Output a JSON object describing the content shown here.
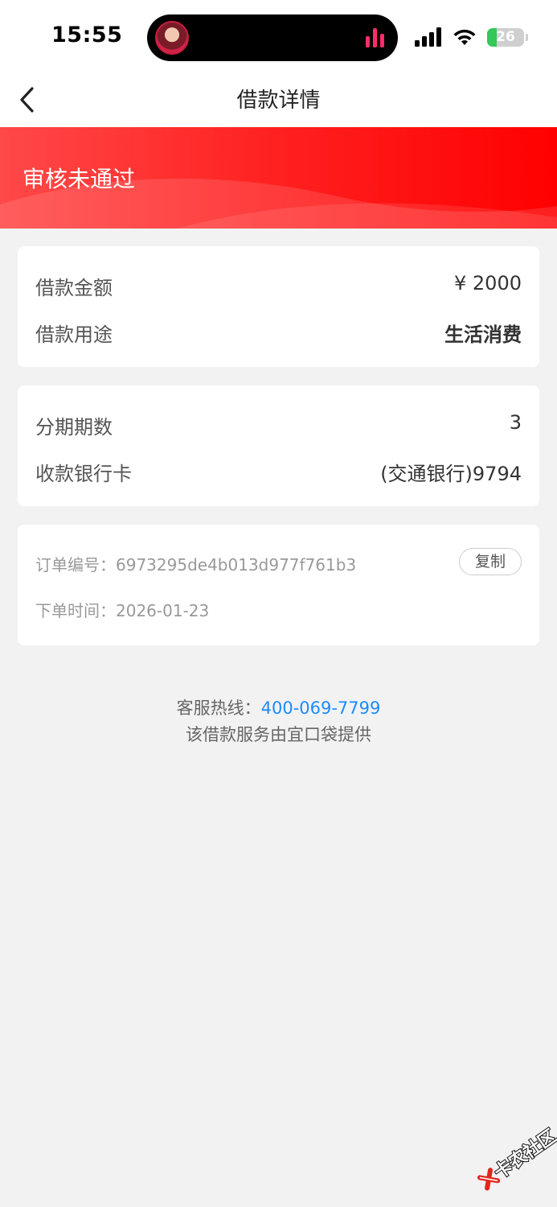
{
  "status_bar": {
    "time": "15:55",
    "battery": "26",
    "battery_level": 0.26
  },
  "nav": {
    "title": "借款详情"
  },
  "banner": {
    "status": "审核未通过"
  },
  "loan_card": {
    "amount_label": "借款金额",
    "amount_value": "¥ 2000",
    "purpose_label": "借款用途",
    "purpose_value": "生活消费"
  },
  "installment_card": {
    "periods_label": "分期期数",
    "periods_value": "3",
    "bank_label": "收款银行卡",
    "bank_value": "(交通银行)9794"
  },
  "order_card": {
    "order_no_label": "订单编号：",
    "order_no_value": "6973295de4b013d977f761b3",
    "copy_label": "复制",
    "order_time_label": "下单时间：",
    "order_time_value": "2026-01-23"
  },
  "footer": {
    "hotline_label": "客服热线：",
    "hotline_number": "400-069-7799",
    "provider": "该借款服务由宜口袋提供"
  },
  "watermark": {
    "text": "卡农社区"
  },
  "colors": {
    "accent": "#ff0000",
    "link": "#1a8cff",
    "background": "#f2f2f2"
  }
}
